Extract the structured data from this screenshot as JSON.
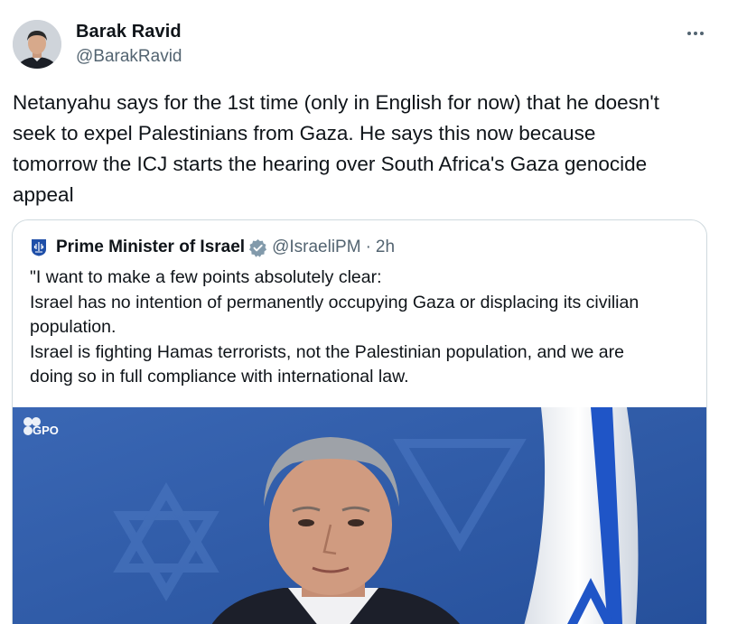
{
  "tweet": {
    "author": {
      "name": "Barak Ravid",
      "handle": "@BarakRavid"
    },
    "text": "Netanyahu says for the 1st time (only in English for now) that he doesn't\nseek to expel Palestinians from Gaza. He says this now because\ntomorrow the ICJ starts the hearing over South Africa's Gaza genocide\nappeal",
    "more_icon": "more-horizontal-icon"
  },
  "quote": {
    "author_name": "Prime Minister of Israel",
    "handle": "@IsraeliPM",
    "separator": "·",
    "time": "2h",
    "verified_icon": "verified-badge-icon",
    "emblem_icon": "israel-emblem-icon",
    "text": "\"I want to make a few points absolutely clear:\nIsrael has no intention of permanently occupying Gaza or displacing its civilian\npopulation.\nIsrael is fighting Hamas terrorists, not the Palestinian population, and we are\ndoing so in full compliance with international law.",
    "media": {
      "watermark": "GPO"
    }
  },
  "colors": {
    "text_primary": "#0f1419",
    "text_secondary": "#536471",
    "border": "#cfd9de",
    "verified_gray": "#829aab",
    "flag_blue": "#1f55c7"
  }
}
